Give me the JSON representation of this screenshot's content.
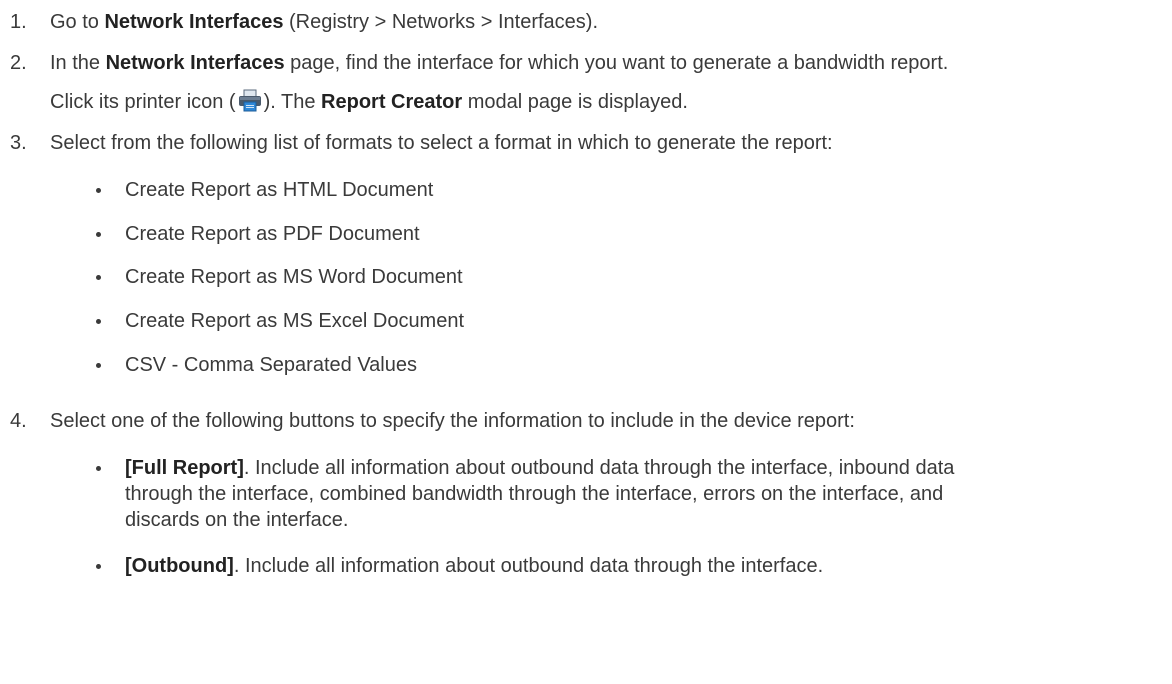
{
  "steps": [
    {
      "number": "1.",
      "parts": [
        "Go to ",
        "Network Interfaces",
        " (Registry > Networks > Interfaces)."
      ]
    },
    {
      "number": "2.",
      "line1": [
        "In the ",
        "Network Interfaces",
        " page, find the interface for which you want to generate a bandwidth report."
      ],
      "line2": [
        "Click its printer icon (",
        "). The ",
        "Report Creator",
        " modal page is displayed."
      ]
    },
    {
      "number": "3.",
      "text": "Select from the following list of formats to select a format in which to generate the report:",
      "bullets": [
        "Create Report as HTML Document",
        "Create Report as PDF Document",
        "Create Report as MS Word Document",
        "Create Report as MS Excel Document",
        "CSV - Comma Separated Values"
      ]
    },
    {
      "number": "4.",
      "text": "Select one of the following buttons to specify the information to include in the device report:",
      "bullets": [
        {
          "label": "[Full Report]",
          "lines": [
            ". Include all information about outbound data through the interface, inbound data",
            "through the interface, combined bandwidth through the interface, errors on the interface, and",
            "discards on the interface."
          ]
        },
        {
          "label": "[Outbound]",
          "lines": [
            ". Include all information about outbound data through the interface."
          ]
        }
      ]
    }
  ],
  "icons": {
    "printer": "printer-icon"
  }
}
